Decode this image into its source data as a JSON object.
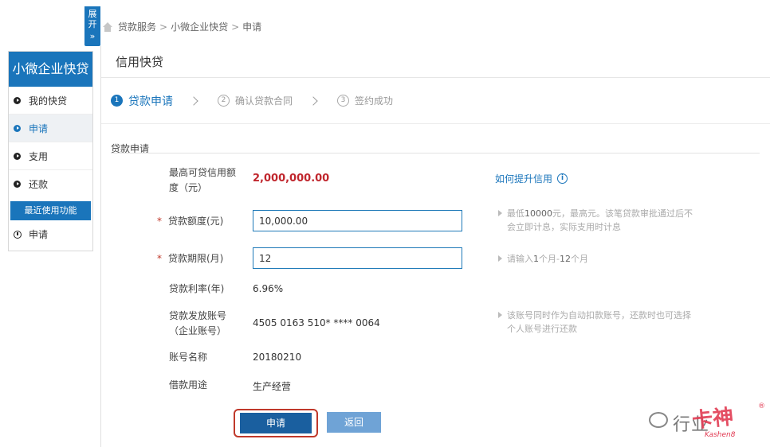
{
  "expand_tab": {
    "label_top": "展",
    "label_bottom": "开",
    "chevron": "»"
  },
  "breadcrumb": {
    "items": [
      "贷款服务",
      "小微企业快贷",
      "申请"
    ],
    "sep": ">"
  },
  "sidebar": {
    "title": "小微企业快贷",
    "items": [
      {
        "label": "我的快贷",
        "active": false
      },
      {
        "label": "申请",
        "active": true
      },
      {
        "label": "支用",
        "active": false
      },
      {
        "label": "还款",
        "active": false
      }
    ],
    "recent_label": "最近使用功能",
    "recent_items": [
      {
        "label": "申请"
      }
    ]
  },
  "panel": {
    "title": "信用快贷"
  },
  "steps": [
    {
      "num": "1",
      "label": "贷款申请",
      "active": true
    },
    {
      "num": "2",
      "label": "确认贷款合同",
      "active": false
    },
    {
      "num": "3",
      "label": "签约成功",
      "active": false
    }
  ],
  "form": {
    "section_title": "贷款申请",
    "max_credit": {
      "label_line1": "最高可贷信用额",
      "label_line2": "度（元）",
      "value": "2,000,000.00"
    },
    "improve_link": {
      "label": "如何提升信用",
      "icon": "i"
    },
    "amount": {
      "label": "贷款额度(元)",
      "value": "10,000.00",
      "required_mark": "*",
      "hint_prefix": "最低",
      "hint_min": "10000",
      "hint_suffix": "元，最高元。该笔贷款审批通过后不",
      "hint_line2": "会立即计息，实际支用时计息"
    },
    "term": {
      "label": "贷款期限(月)",
      "value": "12",
      "required_mark": "*",
      "hint_prefix": "请输入",
      "hint_min": "1",
      "hint_mid": "个月-",
      "hint_max": "12",
      "hint_suffix": "个月"
    },
    "rate": {
      "label": "贷款利率(年)",
      "value": "6.96%"
    },
    "account": {
      "label_line1": "贷款发放账号",
      "label_line2": "（企业账号）",
      "value": "4505 0163 510* **** 0064",
      "hint_line1": "该账号同时作为自动扣款账号，还款时也可选择",
      "hint_line2": "个人账号进行还款"
    },
    "account_name": {
      "label": "账号名称",
      "value": "20180210"
    },
    "purpose": {
      "label": "借款用途",
      "value": "生产经营"
    }
  },
  "buttons": {
    "submit": "申请",
    "back": "返回"
  },
  "watermark": {
    "text": "行业",
    "brand": "卡神",
    "sub": "Kashen8",
    "reg": "®"
  },
  "colors": {
    "primary": "#1a75bb",
    "amount_red": "#c0262d",
    "highlight_border": "#c0392b"
  }
}
